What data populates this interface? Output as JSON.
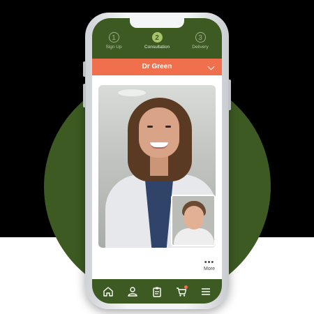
{
  "steps": [
    {
      "number": "1",
      "label": "Sign Up",
      "active": false
    },
    {
      "number": "2",
      "label": "Consultation",
      "active": true
    },
    {
      "number": "3",
      "label": "Delivery",
      "active": false
    }
  ],
  "doctor_select": {
    "selected": "Dr Green"
  },
  "more": {
    "dots": "•••",
    "label": "More"
  },
  "bottom_nav": {
    "items": [
      "home-icon",
      "profile-icon",
      "clipboard-icon",
      "cart-icon",
      "menu-icon"
    ]
  },
  "colors": {
    "primary_green": "#3d5a22",
    "accent_orange": "#f0704e",
    "active_step": "#a6c46a"
  }
}
